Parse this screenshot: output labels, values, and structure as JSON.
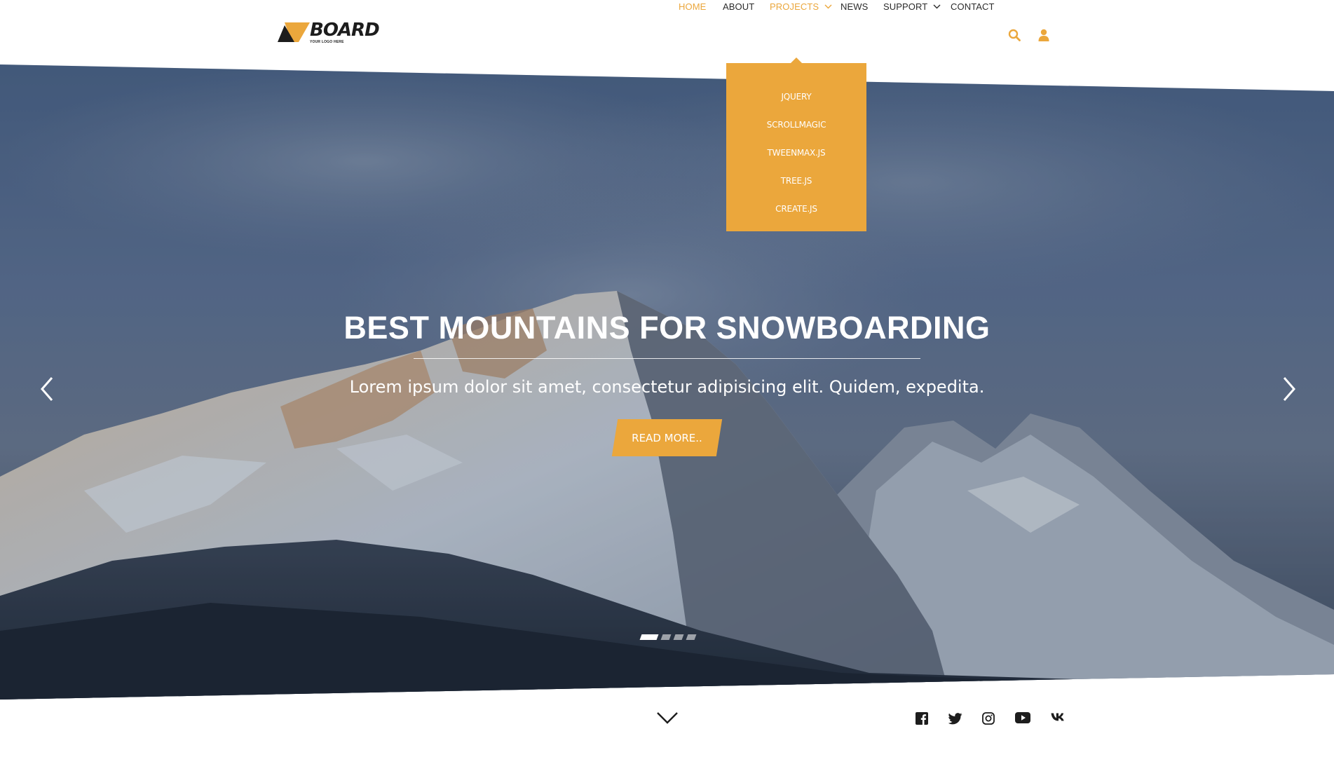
{
  "brand": {
    "name": "BOARD",
    "tagline": "YOUR LOGO HERE",
    "accent_color": "#eba73c",
    "dark_color": "#1d1d1d"
  },
  "nav": {
    "items": [
      {
        "label": "HOME",
        "active": true,
        "has_dropdown": false
      },
      {
        "label": "ABOUT",
        "active": false,
        "has_dropdown": false
      },
      {
        "label": "PROJECTS",
        "active": true,
        "has_dropdown": true
      },
      {
        "label": "NEWS",
        "active": false,
        "has_dropdown": false
      },
      {
        "label": "SUPPORT",
        "active": false,
        "has_dropdown": true
      },
      {
        "label": "CONTACT",
        "active": false,
        "has_dropdown": false
      }
    ],
    "icons": [
      "search-icon",
      "user-icon"
    ]
  },
  "dropdown": {
    "parent": "PROJECTS",
    "items": [
      "JQUERY",
      "SCROLLMAGIC",
      "TWEENMAX.JS",
      "TREE.JS",
      "CREATE.JS"
    ]
  },
  "hero": {
    "title": "BEST MOUNTAINS FOR SNOWBOARDING",
    "subtitle": "Lorem ipsum dolor sit amet, consectetur adipisicing elit. Quidem, expedita.",
    "cta_label": "READ MORE..",
    "slide_count": 4,
    "active_slide": 1
  },
  "social": {
    "icons": [
      "facebook-icon",
      "twitter-icon",
      "instagram-icon",
      "youtube-icon",
      "vk-icon"
    ]
  }
}
